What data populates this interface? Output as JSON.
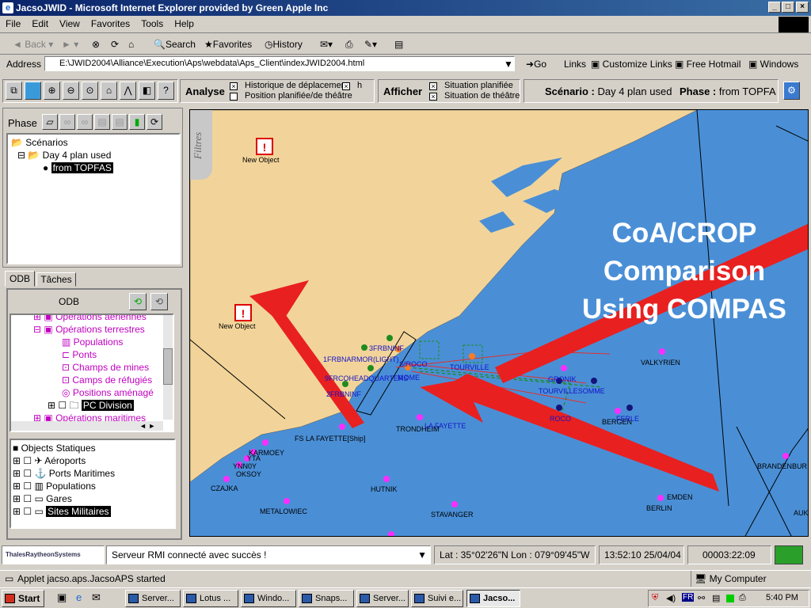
{
  "window": {
    "title": "JacsoJWID - Microsoft Internet Explorer provided by Green Apple Inc"
  },
  "menu": [
    "File",
    "Edit",
    "View",
    "Favorites",
    "Tools",
    "Help"
  ],
  "toolbar": {
    "back": "Back",
    "search": "Search",
    "favorites": "Favorites",
    "history": "History"
  },
  "address": {
    "label": "Address",
    "url": "E:\\JWID2004\\Alliance\\Execution\\Aps\\webdata\\Aps_Client\\indexJWID2004.html",
    "go": "Go",
    "links": "Links",
    "link1": "Customize Links",
    "link2": "Free Hotmail",
    "link3": "Windows"
  },
  "app_toolbar": {
    "analyse": "Analyse",
    "hist": "Historique de déplacement",
    "hist_h": "h",
    "pos": "Position planifiée/de théâtre",
    "afficher": "Afficher",
    "sit_plan": "Situation planifiée",
    "sit_theatre": "Situation de théâtre",
    "scenario_label": "Scénario :",
    "scenario_value": "Day 4 plan used",
    "phase_label": "Phase :",
    "phase_value": "from TOPFA"
  },
  "phase_panel": {
    "title": "Phase",
    "root": "Scénarios",
    "child": "Day 4 plan used",
    "leaf": "from TOPFAS"
  },
  "tabs": [
    "ODB",
    "Tâches"
  ],
  "odb": {
    "title": "ODB",
    "items": [
      "Opérations aériennes",
      "Opérations terrestres",
      "Populations",
      "Ponts",
      "Champs de mines",
      "Camps de réfugiés",
      "Positions aménagé",
      "PC Division",
      "Opérations maritimes"
    ]
  },
  "static_objects": {
    "title": "Objects Statiques",
    "items": [
      "Aéroports",
      "Ports Maritimes",
      "Populations",
      "Gares",
      "Sites Militaires"
    ]
  },
  "map": {
    "filter_tab": "Filtres",
    "overlay_lines": [
      "CoA/CROP",
      "Comparison",
      "Using COMPAS"
    ],
    "new_object": "New Object",
    "black_labels": [
      "FS LA FAYETTE[Ship]",
      "KARMOEY",
      "OKSOY",
      "CZAJKA",
      "HUTNIK",
      "METALOWIEC",
      "STAVANGER",
      "TRONDHEIM",
      "BERGEN",
      "BERLIN",
      "EMDEN",
      "VALKYRIEN",
      "BRANDENBUR",
      "AUK",
      "YTA",
      "YNN0Y"
    ],
    "blue_labels": [
      "3FRBNINF",
      "1FRBNARMOR(LIGHT)",
      "9FRCOHEADQUARTERS",
      "2FRBNINF",
      "SIROCO",
      "MOME",
      "TOURVILLE",
      "GRONIK",
      "TOURVILLESOMME",
      "FERLE",
      "ROCO",
      "LA FAYETTE"
    ]
  },
  "status": {
    "message": "Serveur RMI connecté avec succès !",
    "coords": "Lat : 35°02'26\"N  Lon : 079°09'45\"W",
    "datetime": "13:52:10 25/04/04",
    "counter": "00003:22:09",
    "logo": "ThalesRaytheonSystems"
  },
  "ie_status": {
    "text": "Applet jacso.aps.JacsoAPS started",
    "zone": "My Computer"
  },
  "taskbar": {
    "start": "Start",
    "tasks": [
      "Server...",
      "Lotus ...",
      "Windo...",
      "Snaps...",
      "Server...",
      "Suivi e...",
      "Jacso..."
    ],
    "clock": "5:40 PM",
    "lang": "FR"
  },
  "colors": {
    "sea": "#4a8fd6",
    "land": "#f2d49a",
    "arrow": "#ee1c1c",
    "friendly": "#1e8c1e",
    "hostile": "#ff00ff",
    "neutral": "#1414a0"
  }
}
